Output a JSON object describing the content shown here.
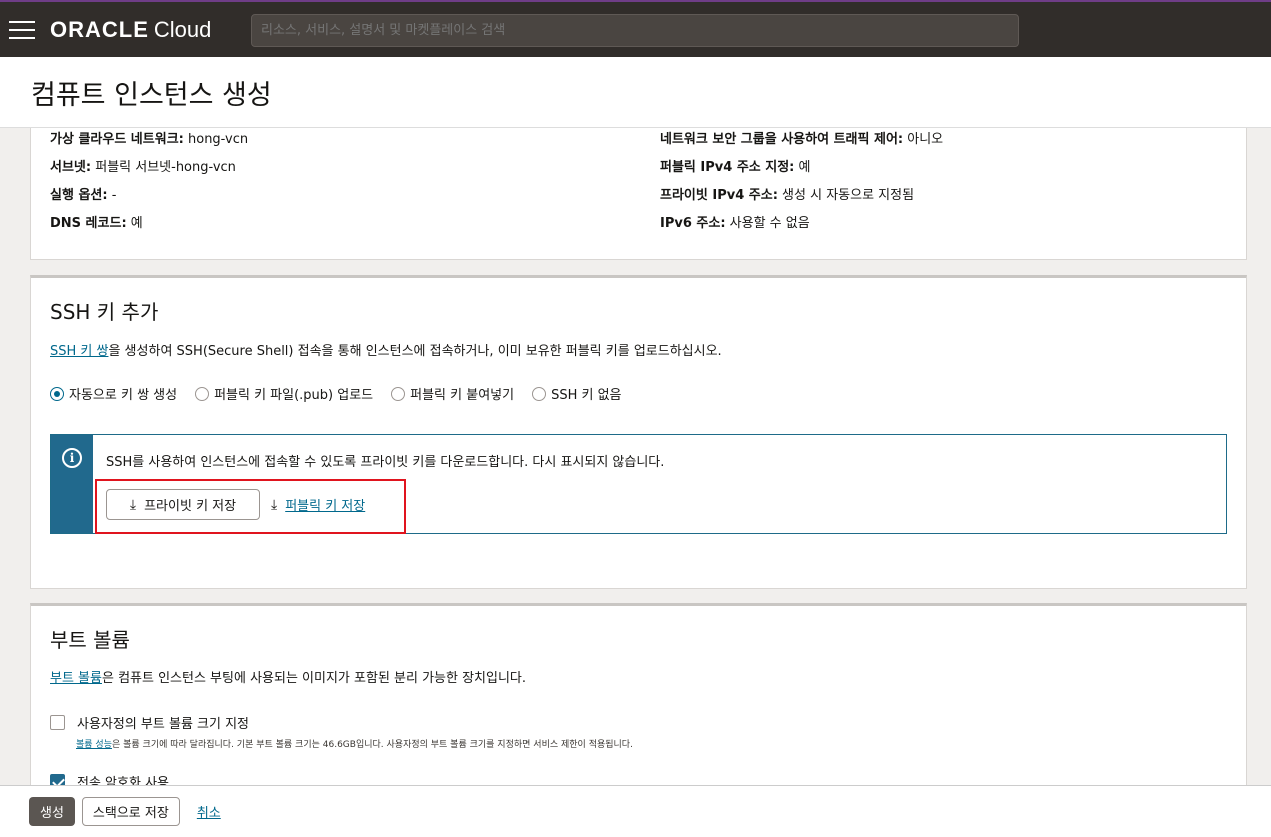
{
  "header": {
    "logo_oracle": "ORACLE",
    "logo_cloud": "Cloud",
    "search_placeholder": "리소스, 서비스, 설명서 및 마켓플레이스 검색"
  },
  "page_title": "컴퓨트 인스턴스 생성",
  "network_summary": {
    "left": [
      {
        "label": "가상 클라우드 네트워크:",
        "value": "hong-vcn"
      },
      {
        "label": "서브넷:",
        "value": "퍼블릭 서브넷-hong-vcn"
      },
      {
        "label": "실행 옵션:",
        "value": "-"
      },
      {
        "label": "DNS 레코드:",
        "value": "예"
      }
    ],
    "right": [
      {
        "label": "네트워크 보안 그룹을 사용하여 트래픽 제어:",
        "value": "아니오"
      },
      {
        "label": "퍼블릭 IPv4 주소 지정:",
        "value": "예"
      },
      {
        "label": "프라이빗 IPv4 주소:",
        "value": "생성 시 자동으로 지정됨"
      },
      {
        "label": "IPv6 주소:",
        "value": "사용할 수 없음"
      }
    ]
  },
  "ssh": {
    "title": "SSH 키 추가",
    "desc_link": "SSH 키 쌍",
    "desc_rest": "을 생성하여 SSH(Secure Shell) 접속을 통해 인스턴스에 접속하거나, 이미 보유한 퍼블릭 키를 업로드하십시오.",
    "options": [
      "자동으로 키 쌍 생성",
      "퍼블릭 키 파일(.pub) 업로드",
      "퍼블릭 키 붙여넣기",
      "SSH 키 없음"
    ],
    "selected_option": "자동으로 키 쌍 생성",
    "info_text": "SSH를 사용하여 인스턴스에 접속할 수 있도록 프라이빗 키를 다운로드합니다. 다시 표시되지 않습니다.",
    "save_private_label": "프라이빗 키 저장",
    "save_public_label": "퍼블릭 키 저장"
  },
  "boot": {
    "title": "부트 볼륨",
    "desc_link": "부트 볼륨",
    "desc_rest": "은 컴퓨트 인스턴스 부팅에 사용되는 이미지가 포함된 분리 가능한 장치입니다.",
    "custom_size_label": "사용자정의 부트 볼륨 크기 지정",
    "custom_size_checked": false,
    "note_link": "볼륨 성능",
    "note_rest": "은 볼륨 크기에 따라 달라집니다. 기본 부트 볼륨 크기는 46.6GB입니다. 사용자정의 부트 볼륨 크기를 지정하면 서비스 제한이 적용됩니다.",
    "transit_label": "전송 암호화 사용",
    "transit_checked": true
  },
  "footer": {
    "create_label": "생성",
    "save_stack_label": "스택으로 저장",
    "cancel_label": "취소"
  }
}
